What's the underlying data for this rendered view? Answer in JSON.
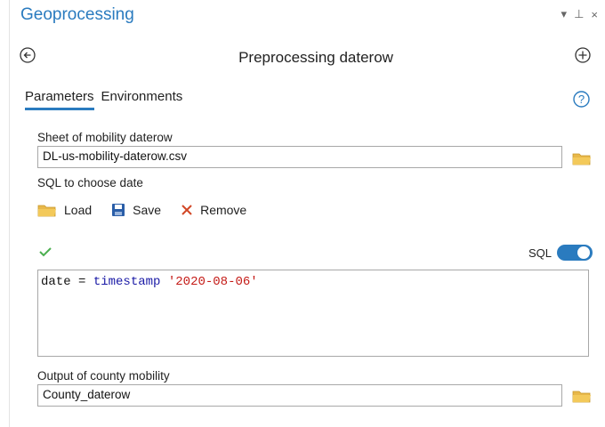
{
  "pane": {
    "title": "Geoprocessing",
    "pin_glyph": "▾ ⊥",
    "close_glyph": "×"
  },
  "tool": {
    "title": "Preprocessing daterow"
  },
  "tabs": [
    {
      "label": "Parameters",
      "active": true
    },
    {
      "label": "Environments",
      "active": false
    }
  ],
  "params": {
    "sheet_label": "Sheet of mobility daterow",
    "sheet_value": "DL-us-mobility-daterow.csv",
    "sql_label": "SQL to choose date",
    "load_label": "Load",
    "save_label": "Save",
    "remove_label": "Remove",
    "sql_toggle_label": "SQL",
    "sql_toggle_on": true,
    "sql_field": "date",
    "sql_operator": "=",
    "sql_keyword": "timestamp",
    "sql_string": "'2020-08-06'",
    "output_label": "Output of county mobility",
    "output_value": "County_daterow"
  },
  "colors": {
    "accent": "#2a7bbf",
    "folder": "#e8b84a",
    "remove": "#d24726",
    "check": "#4caf50",
    "keyword": "#1a1aa6",
    "string": "#c41a16"
  },
  "icons": [
    "back-arrow-icon",
    "add-icon",
    "help-icon",
    "folder-icon",
    "save-icon",
    "remove-icon",
    "check-icon"
  ]
}
